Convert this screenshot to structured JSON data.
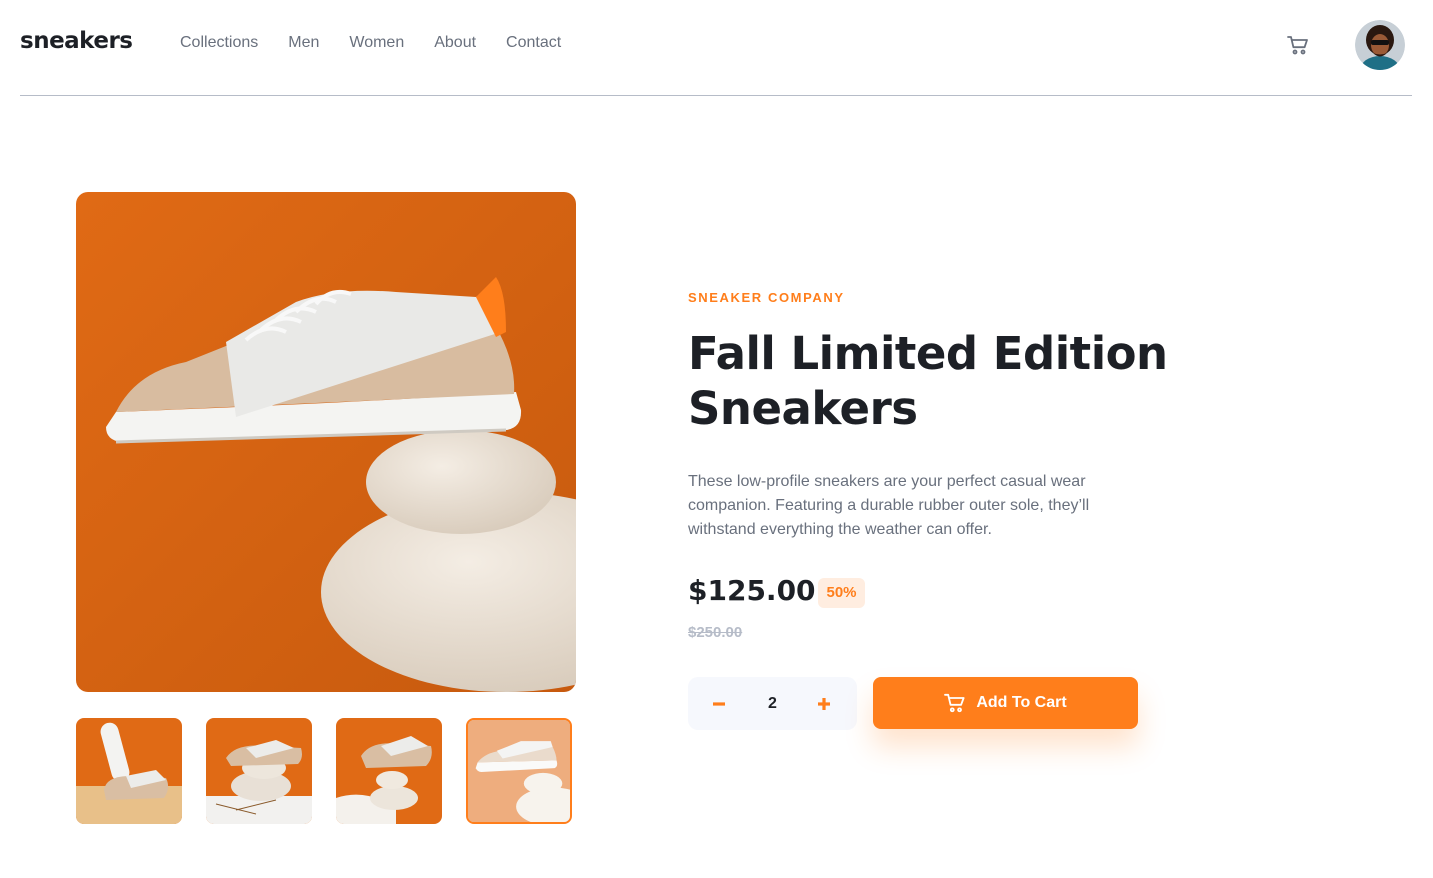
{
  "header": {
    "logo": "sneakers",
    "nav": [
      "Collections",
      "Men",
      "Women",
      "About",
      "Contact"
    ],
    "cart_icon": "cart-icon",
    "avatar_icon": "user-avatar"
  },
  "gallery": {
    "main_image": "white-sneaker-on-stones",
    "thumbnails": [
      "thumbnail-1",
      "thumbnail-2",
      "thumbnail-3",
      "thumbnail-4"
    ],
    "active_thumbnail": 4
  },
  "product": {
    "brand": "SNEAKER COMPANY",
    "title": "Fall Limited Edition Sneakers",
    "description": "These low-profile sneakers are your perfect casual wear companion. Featuring a durable rubber outer sole, they’ll withstand everything the weather can offer.",
    "price": "$125.00",
    "discount": "50%",
    "old_price": "$250.00"
  },
  "cart_controls": {
    "minus": "–",
    "quantity": "2",
    "plus": "+",
    "add_label": "Add To Cart"
  },
  "colors": {
    "accent": "#ff7e1b",
    "accent_pale": "#ffede0",
    "text_dark": "#1d2026",
    "text_gray": "#69707d",
    "bg_light": "#f6f8fd",
    "product_orange": "#e26a12"
  }
}
